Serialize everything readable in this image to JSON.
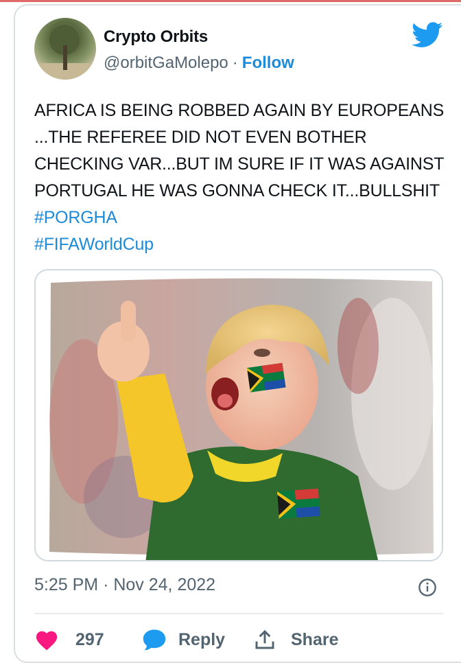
{
  "author": {
    "display_name": "Crypto Orbits",
    "handle": "@orbitGaMolepo",
    "separator": "·",
    "follow_label": "Follow"
  },
  "tweet": {
    "text": "AFRICA IS BEING ROBBED AGAIN BY EUROPEANS ...THE REFEREE DID NOT EVEN BOTHER CHECKING VAR...BUT IM SURE IF IT WAS AGAINST PORTUGAL HE WAS GONNA CHECK IT...BULLSHIT ",
    "hashtag_1": "#PORGHA",
    "hashtag_2": "#FIFAWorldCup"
  },
  "media": {
    "icon": "child-fan-photo"
  },
  "meta": {
    "time": "5:25 PM",
    "separator": "·",
    "date": "Nov 24, 2022"
  },
  "actions": {
    "like_count": "297",
    "reply_label": "Reply",
    "share_label": "Share"
  },
  "colors": {
    "accent": "#1d9bf0",
    "like": "#f91880",
    "text": "#0f1419",
    "secondary": "#536471"
  }
}
